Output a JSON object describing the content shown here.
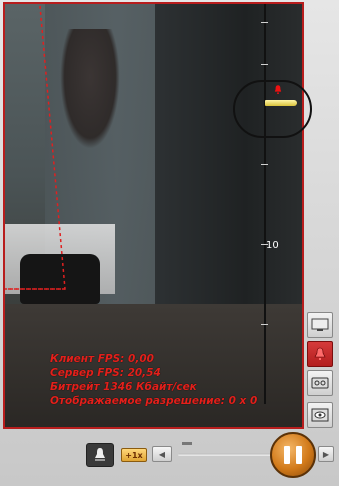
{
  "stats": {
    "client_fps": "Клиент FPS: 0,00",
    "server_fps": "Сервер FPS: 20,54",
    "bitrate": "Битрейт 1346 Кбайт/сек",
    "resolution": "Отображаемое разрешение: 0 x 0"
  },
  "timeline": {
    "label": "10"
  },
  "controls": {
    "speed_label": "+1x"
  },
  "icons": {
    "alarm": "bell-icon",
    "monitor": "monitor-icon",
    "events": "bell-icon",
    "archive": "tape-icon",
    "view": "eye-icon"
  },
  "colors": {
    "accent": "#b81d1d",
    "stats_text": "#e3201b",
    "pause_button": "#d27a1a"
  }
}
